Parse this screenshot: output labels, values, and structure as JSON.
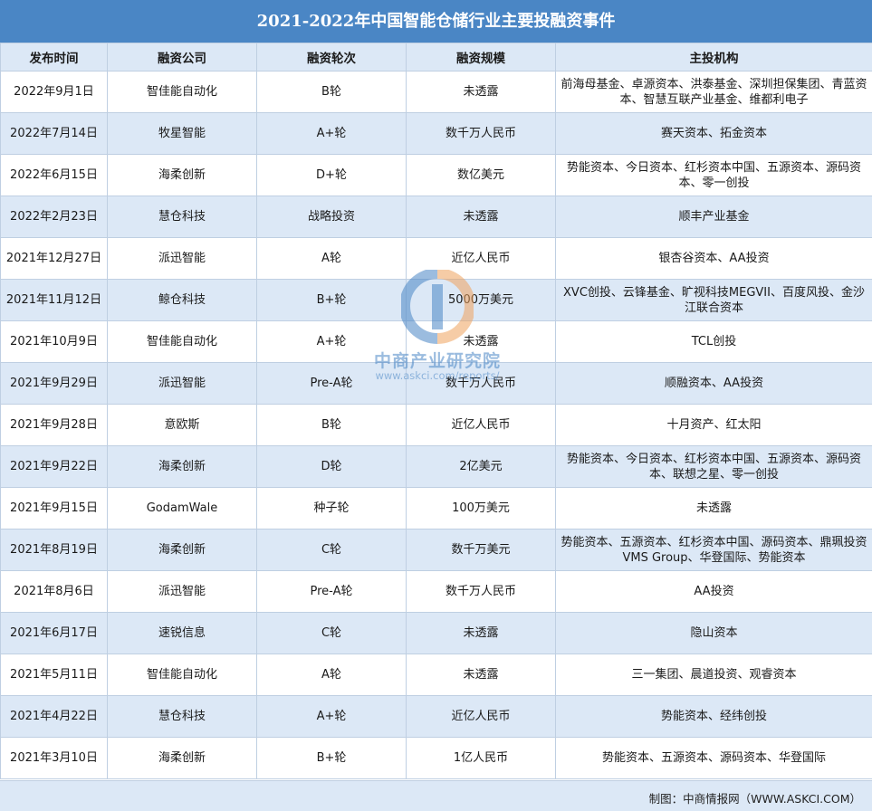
{
  "title": "2021-2022年中国智能仓储行业主要投融资事件",
  "columns": [
    "发布时间",
    "融资公司",
    "融资轮次",
    "融资规模",
    "主投机构"
  ],
  "rows": [
    [
      "2022年9月1日",
      "智佳能自动化",
      "B轮",
      "未透露",
      "前海母基金、卓源资本、洪泰基金、深圳担保集团、青蓝资本、智慧互联产业基金、维都利电子"
    ],
    [
      "2022年7月14日",
      "牧星智能",
      "A+轮",
      "数千万人民币",
      "赛天资本、拓金资本"
    ],
    [
      "2022年6月15日",
      "海柔创新",
      "D+轮",
      "数亿美元",
      "势能资本、今日资本、红杉资本中国、五源资本、源码资本、零一创投"
    ],
    [
      "2022年2月23日",
      "慧仓科技",
      "战略投资",
      "未透露",
      "顺丰产业基金"
    ],
    [
      "2021年12月27日",
      "派迅智能",
      "A轮",
      "近亿人民币",
      "银杏谷资本、AA投资"
    ],
    [
      "2021年11月12日",
      "鲸仓科技",
      "B+轮",
      "5000万美元",
      "XVC创投、云锋基金、旷视科技MEGVII、百度风投、金沙江联合资本"
    ],
    [
      "2021年10月9日",
      "智佳能自动化",
      "A+轮",
      "未透露",
      "TCL创投"
    ],
    [
      "2021年9月29日",
      "派迅智能",
      "Pre-A轮",
      "数千万人民币",
      "顺融资本、AA投资"
    ],
    [
      "2021年9月28日",
      "意欧斯",
      "B轮",
      "近亿人民币",
      "十月资产、红太阳"
    ],
    [
      "2021年9月22日",
      "海柔创新",
      "D轮",
      "2亿美元",
      "势能资本、今日资本、红杉资本中国、五源资本、源码资本、联想之星、零一创投"
    ],
    [
      "2021年9月15日",
      "GodamWale",
      "种子轮",
      "100万美元",
      "未透露"
    ],
    [
      "2021年8月19日",
      "海柔创新",
      "C轮",
      "数千万美元",
      "势能资本、五源资本、红杉资本中国、源码资本、鼎珮投资VMS Group、华登国际、势能资本"
    ],
    [
      "2021年8月6日",
      "派迅智能",
      "Pre-A轮",
      "数千万人民币",
      "AA投资"
    ],
    [
      "2021年6月17日",
      "速锐信息",
      "C轮",
      "未透露",
      "隐山资本"
    ],
    [
      "2021年5月11日",
      "智佳能自动化",
      "A轮",
      "未透露",
      "三一集团、晨道投资、观睿资本"
    ],
    [
      "2021年4月22日",
      "慧仓科技",
      "A+轮",
      "近亿人民币",
      "势能资本、经纬创投"
    ],
    [
      "2021年3月10日",
      "海柔创新",
      "B+轮",
      "1亿人民币",
      "势能资本、五源资本、源码资本、华登国际"
    ]
  ],
  "footer": "制图：中商情报网（WWW.ASKCI.COM）",
  "watermark": {
    "name": "中商产业研究院",
    "url": "www.askci.com/reports/"
  },
  "colors": {
    "header_bar": "#4a86c5",
    "stripe": "#dce8f6",
    "border": "#bfcfe2",
    "logo_orange": "#f0a35e"
  }
}
